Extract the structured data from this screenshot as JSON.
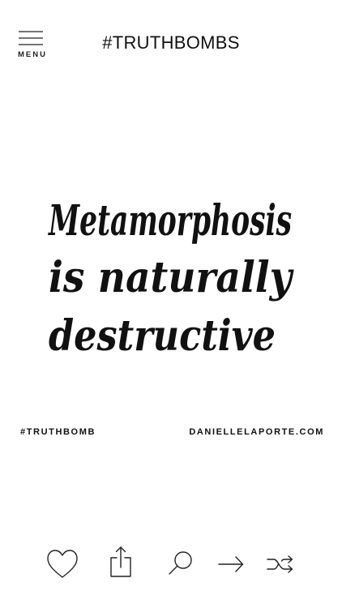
{
  "header": {
    "menu_label": "MENU",
    "title": "#TRUTHBOMBS"
  },
  "quote": {
    "lines": [
      "Metamorphosis",
      "is naturally",
      "destructive"
    ],
    "style": "handwritten"
  },
  "footer": {
    "hashtag": "#TRUTHBOMB",
    "website": "DANIELLELAPORTE.COM"
  },
  "toolbar": {
    "items": [
      {
        "name": "favorite",
        "icon": "heart-icon"
      },
      {
        "name": "share",
        "icon": "share-icon"
      },
      {
        "name": "search",
        "icon": "search-icon"
      },
      {
        "name": "next",
        "icon": "arrow-right-icon"
      },
      {
        "name": "shuffle",
        "icon": "shuffle-icon"
      }
    ]
  },
  "colors": {
    "background": "#ffffff",
    "ink": "#111111"
  }
}
